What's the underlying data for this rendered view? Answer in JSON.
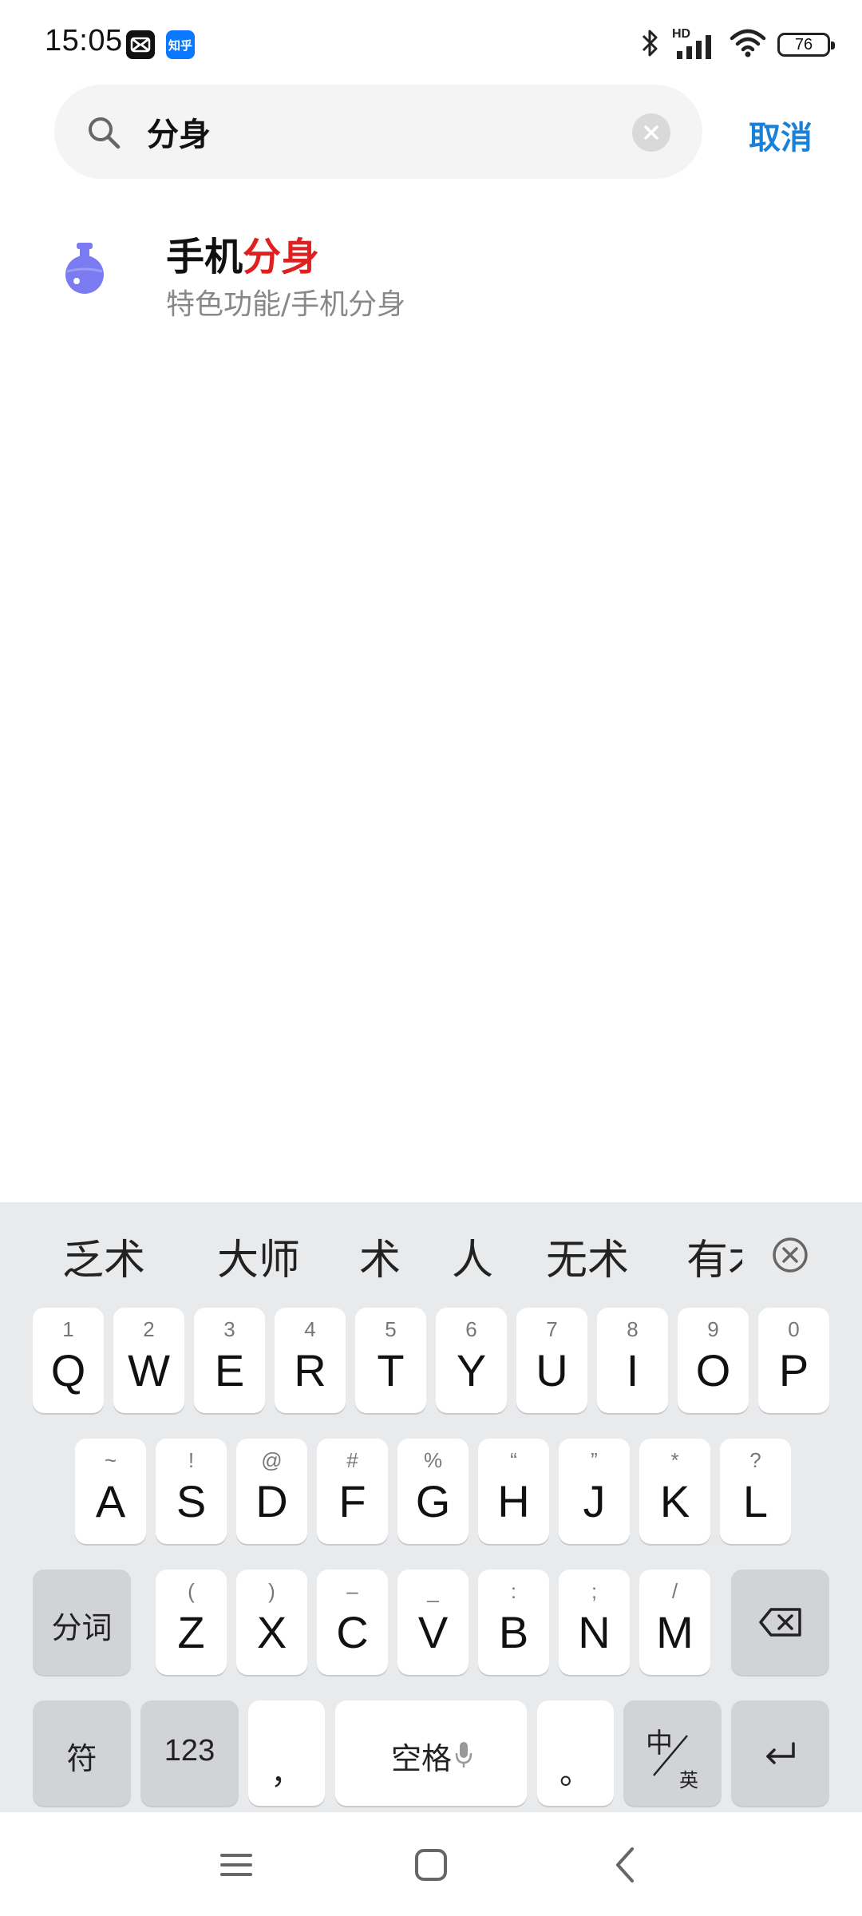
{
  "status_bar": {
    "time": "15:05",
    "notification_icons": [
      "capcut-icon",
      "zhihu-icon"
    ],
    "zhihu_label": "知乎",
    "hd_label": "HD",
    "battery": "76"
  },
  "search": {
    "query": "分身",
    "cancel_label": "取消"
  },
  "results": [
    {
      "title_prefix": "手机",
      "title_highlight": "分身",
      "subtitle": "特色功能/手机分身",
      "icon": "flask-icon",
      "icon_color": "#7b7bf2"
    }
  ],
  "keyboard": {
    "candidates": [
      "乏术",
      "大师",
      "术",
      "人",
      "无术",
      "有术"
    ],
    "row1": [
      {
        "hint": "1",
        "key": "Q"
      },
      {
        "hint": "2",
        "key": "W"
      },
      {
        "hint": "3",
        "key": "E"
      },
      {
        "hint": "4",
        "key": "R"
      },
      {
        "hint": "5",
        "key": "T"
      },
      {
        "hint": "6",
        "key": "Y"
      },
      {
        "hint": "7",
        "key": "U"
      },
      {
        "hint": "8",
        "key": "I"
      },
      {
        "hint": "9",
        "key": "O"
      },
      {
        "hint": "0",
        "key": "P"
      }
    ],
    "row2": [
      {
        "hint": "~",
        "key": "A"
      },
      {
        "hint": "!",
        "key": "S"
      },
      {
        "hint": "@",
        "key": "D"
      },
      {
        "hint": "#",
        "key": "F"
      },
      {
        "hint": "%",
        "key": "G"
      },
      {
        "hint": "“",
        "key": "H"
      },
      {
        "hint": "”",
        "key": "J"
      },
      {
        "hint": "*",
        "key": "K"
      },
      {
        "hint": "?",
        "key": "L"
      }
    ],
    "row3": [
      {
        "hint": "(",
        "key": "Z"
      },
      {
        "hint": ")",
        "key": "X"
      },
      {
        "hint": "–",
        "key": "C"
      },
      {
        "hint": "_",
        "key": "V"
      },
      {
        "hint": ":",
        "key": "B"
      },
      {
        "hint": ";",
        "key": "N"
      },
      {
        "hint": "/",
        "key": "M"
      }
    ],
    "fenci_label": "分词",
    "symbol_label": "符",
    "number_label": "123",
    "comma_label": "，",
    "space_label": "空格",
    "period_label": "。",
    "lang_top": "中",
    "lang_bottom": "英"
  },
  "colors": {
    "accent": "#1982d8",
    "highlight": "#e02020",
    "keyboard_bg": "#e9eaec"
  }
}
